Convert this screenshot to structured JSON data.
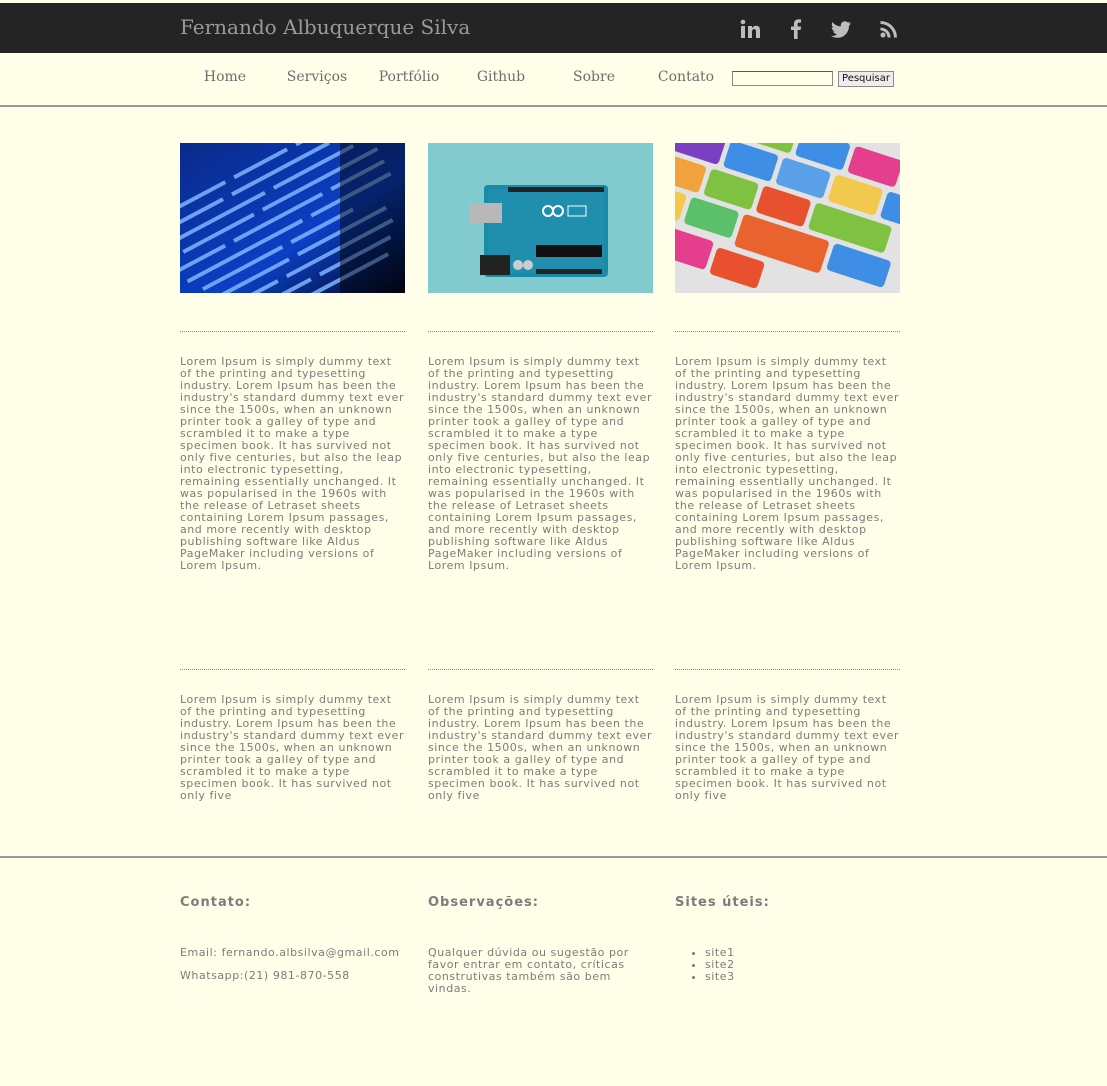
{
  "header": {
    "site_title": "Fernando Albuquerque Silva",
    "social": [
      {
        "icon": "linkedin-icon"
      },
      {
        "icon": "facebook-icon"
      },
      {
        "icon": "twitter-icon"
      },
      {
        "icon": "rss-icon"
      }
    ]
  },
  "nav": {
    "items": [
      "Home",
      "Serviços",
      "Portfólio",
      "Github",
      "Sobre",
      "Contato"
    ],
    "search_value": "",
    "search_button": "Pesquisar"
  },
  "cards": [
    {
      "image": "code-screen-image"
    },
    {
      "image": "arduino-board-image"
    },
    {
      "image": "programming-keyboard-image"
    }
  ],
  "content": {
    "long_text": "Lorem Ipsum is simply dummy text of the printing and typesetting industry. Lorem Ipsum has been the industry's standard dummy text ever since the 1500s, when an unknown printer took a galley of type and scrambled it to make a type specimen book. It has survived not only five centuries, but also the leap into electronic typesetting, remaining essentially unchanged. It was popularised in the 1960s with the release of Letraset sheets containing Lorem Ipsum passages, and more recently with desktop publishing software like Aldus PageMaker including versions of Lorem Ipsum.",
    "short_text": "Lorem Ipsum is simply dummy text of the printing and typesetting industry. Lorem Ipsum has been the industry's standard dummy text ever since the 1500s, when an unknown printer took a galley of type and scrambled it to make a type specimen book. It has survived not only five"
  },
  "footer": {
    "contact": {
      "heading": "Contato:",
      "email": "Email: fernando.albsilva@gmail.com",
      "whatsapp": "Whatsapp:(21) 981-870-558"
    },
    "notes": {
      "heading": "Observações:",
      "text": "Qualquer dúvida ou sugestão por favor entrar em contato, críticas construtivas também são bem vindas."
    },
    "sites": {
      "heading": "Sites úteis:",
      "items": [
        "site1",
        "site2",
        "site3"
      ]
    }
  },
  "colors": {
    "background": "#fffee8",
    "topbar": "#242424",
    "text": "#7c7c7c"
  }
}
